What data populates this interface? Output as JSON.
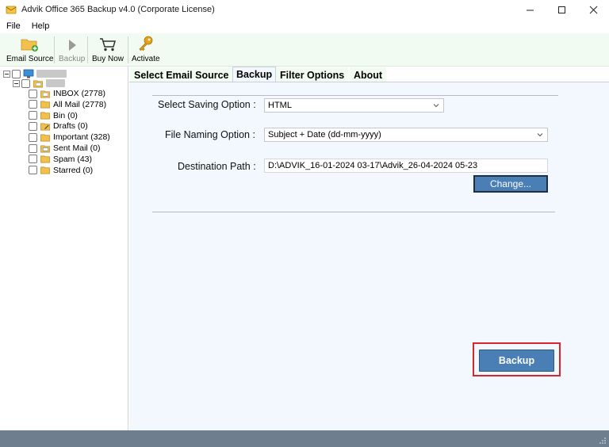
{
  "window": {
    "title": "Advik Office 365 Backup v4.0 (Corporate License)"
  },
  "menu": {
    "file": "File",
    "help": "Help"
  },
  "toolbar": {
    "email_source": "Email Source",
    "backup": "Backup",
    "buy_now": "Buy Now",
    "activate": "Activate"
  },
  "tree": {
    "folders": [
      {
        "label": "INBOX (2778)",
        "icon": "inbox-folder-icon"
      },
      {
        "label": "All Mail (2778)",
        "icon": "folder-icon"
      },
      {
        "label": "Bin (0)",
        "icon": "folder-icon"
      },
      {
        "label": "Drafts (0)",
        "icon": "drafts-folder-icon"
      },
      {
        "label": "Important (328)",
        "icon": "folder-icon"
      },
      {
        "label": "Sent Mail (0)",
        "icon": "sent-folder-icon"
      },
      {
        "label": "Spam (43)",
        "icon": "folder-icon"
      },
      {
        "label": "Starred (0)",
        "icon": "folder-icon"
      }
    ]
  },
  "tabs": [
    "Select Email Source",
    "Backup",
    "Filter Options",
    "About"
  ],
  "active_tab": "Backup",
  "form": {
    "saving_option_label": "Select Saving Option :",
    "saving_option_value": "HTML",
    "naming_option_label": "File Naming Option :",
    "naming_option_value": "Subject + Date (dd-mm-yyyy)",
    "destination_label": "Destination Path :",
    "destination_value": "D:\\ADVIK_16-01-2024 03-17\\Advik_26-04-2024 05-23",
    "change_button": "Change..."
  },
  "actions": {
    "backup_button": "Backup"
  },
  "colors": {
    "toolbar_bg": "#f1fbf1",
    "content_bg": "#f2f8fe",
    "button_blue": "#4a7fb6",
    "highlight_red": "#d9262c",
    "status_bar": "#6e7e8e"
  }
}
